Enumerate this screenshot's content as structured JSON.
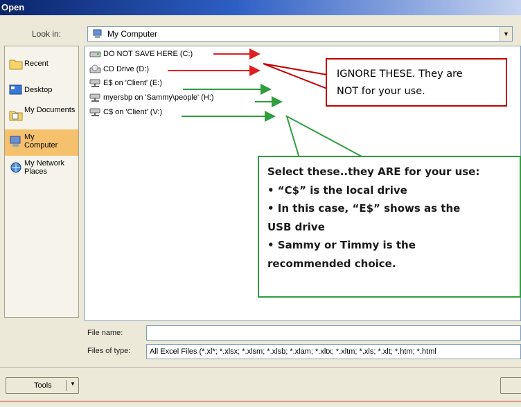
{
  "window": {
    "title": "Open"
  },
  "lookin": {
    "label": "Look in:",
    "value": "My Computer"
  },
  "places": [
    {
      "label": "Recent",
      "icon": "recent-folder-icon"
    },
    {
      "label": "Desktop",
      "icon": "desktop-icon"
    },
    {
      "label": "My Documents",
      "icon": "my-documents-icon"
    },
    {
      "label": "My Computer",
      "icon": "my-computer-icon",
      "selected": true
    },
    {
      "label": "My Network Places",
      "icon": "network-places-icon"
    }
  ],
  "files": [
    {
      "label": "DO NOT SAVE HERE (C:)",
      "icon": "hard-drive-icon"
    },
    {
      "label": "CD Drive (D:)",
      "icon": "cd-drive-icon"
    },
    {
      "label": "E$ on 'Client' (E:)",
      "icon": "network-drive-icon"
    },
    {
      "label": "myersbp on 'Sammy\\people' (H:)",
      "icon": "network-drive-icon"
    },
    {
      "label": "C$ on 'Client' (V:)",
      "icon": "network-drive-icon"
    }
  ],
  "annotations": {
    "red": {
      "line1": "IGNORE THESE. They are",
      "line2": "NOT for your use.",
      "color": "#c00000"
    },
    "green": {
      "lines": [
        "Select these..they ARE for your use:",
        "• “C$” is the local drive",
        "• In this case, “E$” shows as the",
        "USB drive",
        "• Sammy or Timmy is the",
        "recommended choice."
      ],
      "color": "#2e9e3e"
    }
  },
  "filename": {
    "label": "File name:",
    "value": ""
  },
  "filetype": {
    "label": "Files of type:",
    "value": "All Excel Files (*.xl*; *.xlsx; *.xlsm; *.xlsb; *.xlam; *.xltx; *.xltm; *.xls; *.xlt; *.htm; *.html"
  },
  "tools": {
    "label": "Tools"
  }
}
